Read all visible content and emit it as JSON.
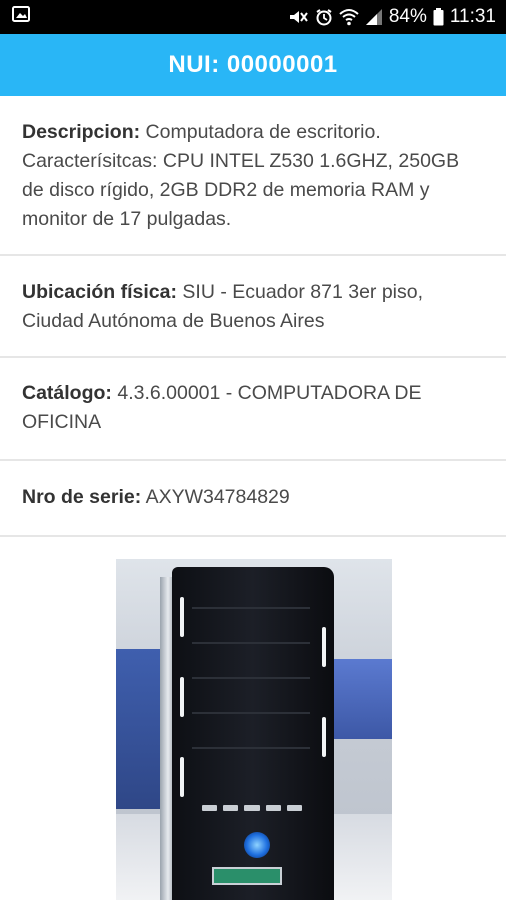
{
  "status_bar": {
    "battery": "84%",
    "time": "11:31",
    "icons": [
      "image-icon",
      "mute-icon",
      "alarm-icon",
      "wifi-icon",
      "signal-icon",
      "battery-icon"
    ]
  },
  "app_bar": {
    "title": "NUI: 00000001",
    "color": "#29b6f6"
  },
  "details": {
    "descripcion": {
      "label": "Descripcion:",
      "value": "Computadora de escritorio. Caracterísitcas: CPU INTEL Z530 1.6GHZ, 250GB de disco rígido, 2GB DDR2 de memoria RAM y monitor de 17 pulgadas."
    },
    "ubicacion": {
      "label": "Ubicación física:",
      "value": "SIU - Ecuador 871 3er piso, Ciudad Autónoma de Buenos Aires"
    },
    "catalogo": {
      "label": "Catálogo:",
      "value": "4.3.6.00001 - COMPUTADORA DE OFICINA"
    },
    "serie": {
      "label": "Nro de serie:",
      "value": "AXYW34784829"
    }
  }
}
